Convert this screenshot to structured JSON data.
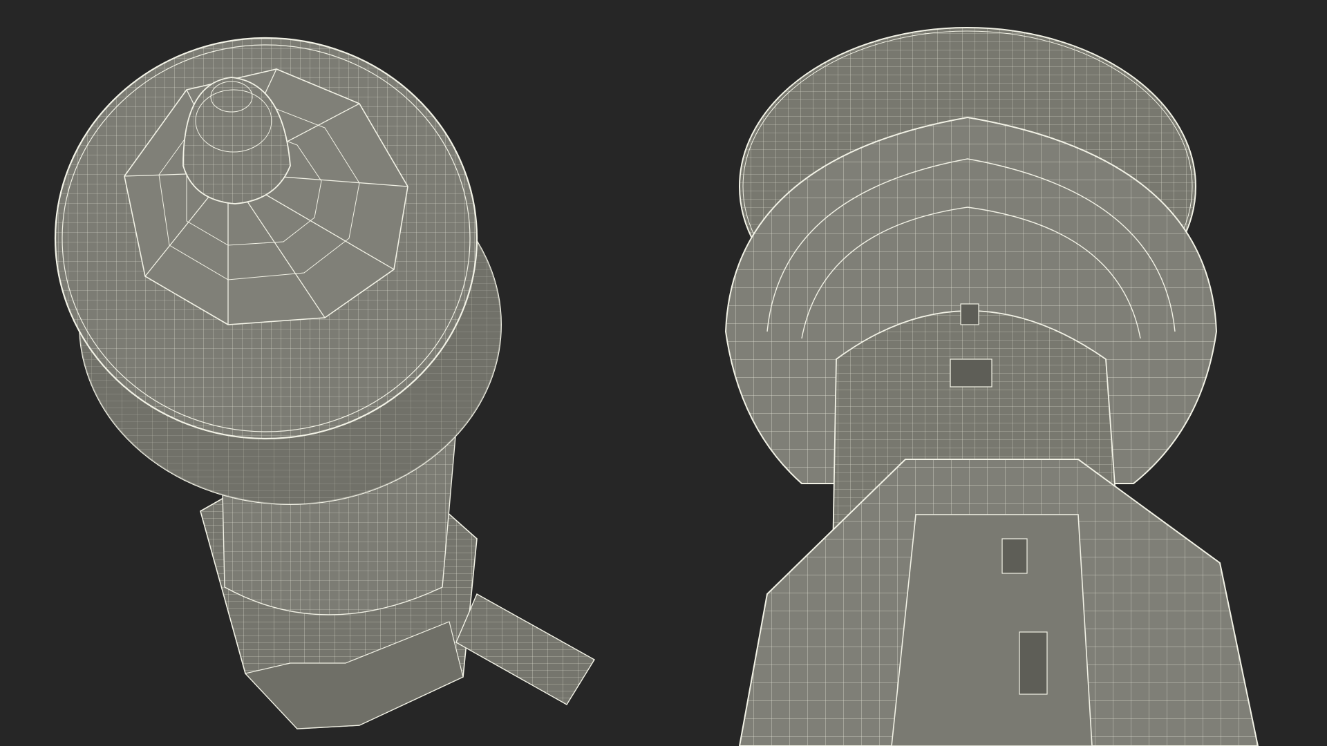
{
  "scene": {
    "description_visible_text": "",
    "background_color": "#262626",
    "mesh_fill_color": "#808078",
    "mesh_fill_dark": "#6c6c64",
    "wire_color": "#f2f2e6",
    "views": [
      {
        "name": "top-down-view"
      },
      {
        "name": "bottom-up-view"
      }
    ]
  }
}
